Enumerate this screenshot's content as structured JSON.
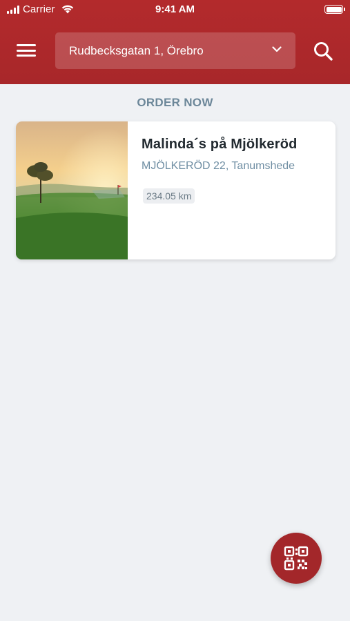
{
  "status_bar": {
    "carrier": "Carrier",
    "time": "9:41 AM"
  },
  "header": {
    "menu_icon": "hamburger-menu-icon",
    "address": "Rudbecksgatan 1, Örebro",
    "dropdown_icon": "chevron-down-icon",
    "search_icon": "search-icon",
    "background_color": "#a8272a"
  },
  "section": {
    "title": "ORDER NOW"
  },
  "restaurants": [
    {
      "name": "Malinda´s på Mjölkeröd",
      "address": "MJÖLKERÖD 22, Tanumshede",
      "distance": "234.05 km",
      "image": "golf-course-sunrise-photo"
    }
  ],
  "fab": {
    "icon": "qr-code-icon",
    "color": "#a3272a"
  },
  "colors": {
    "accent": "#a8272a",
    "section_title": "#6c8799",
    "address_text": "#6f8ea3"
  }
}
